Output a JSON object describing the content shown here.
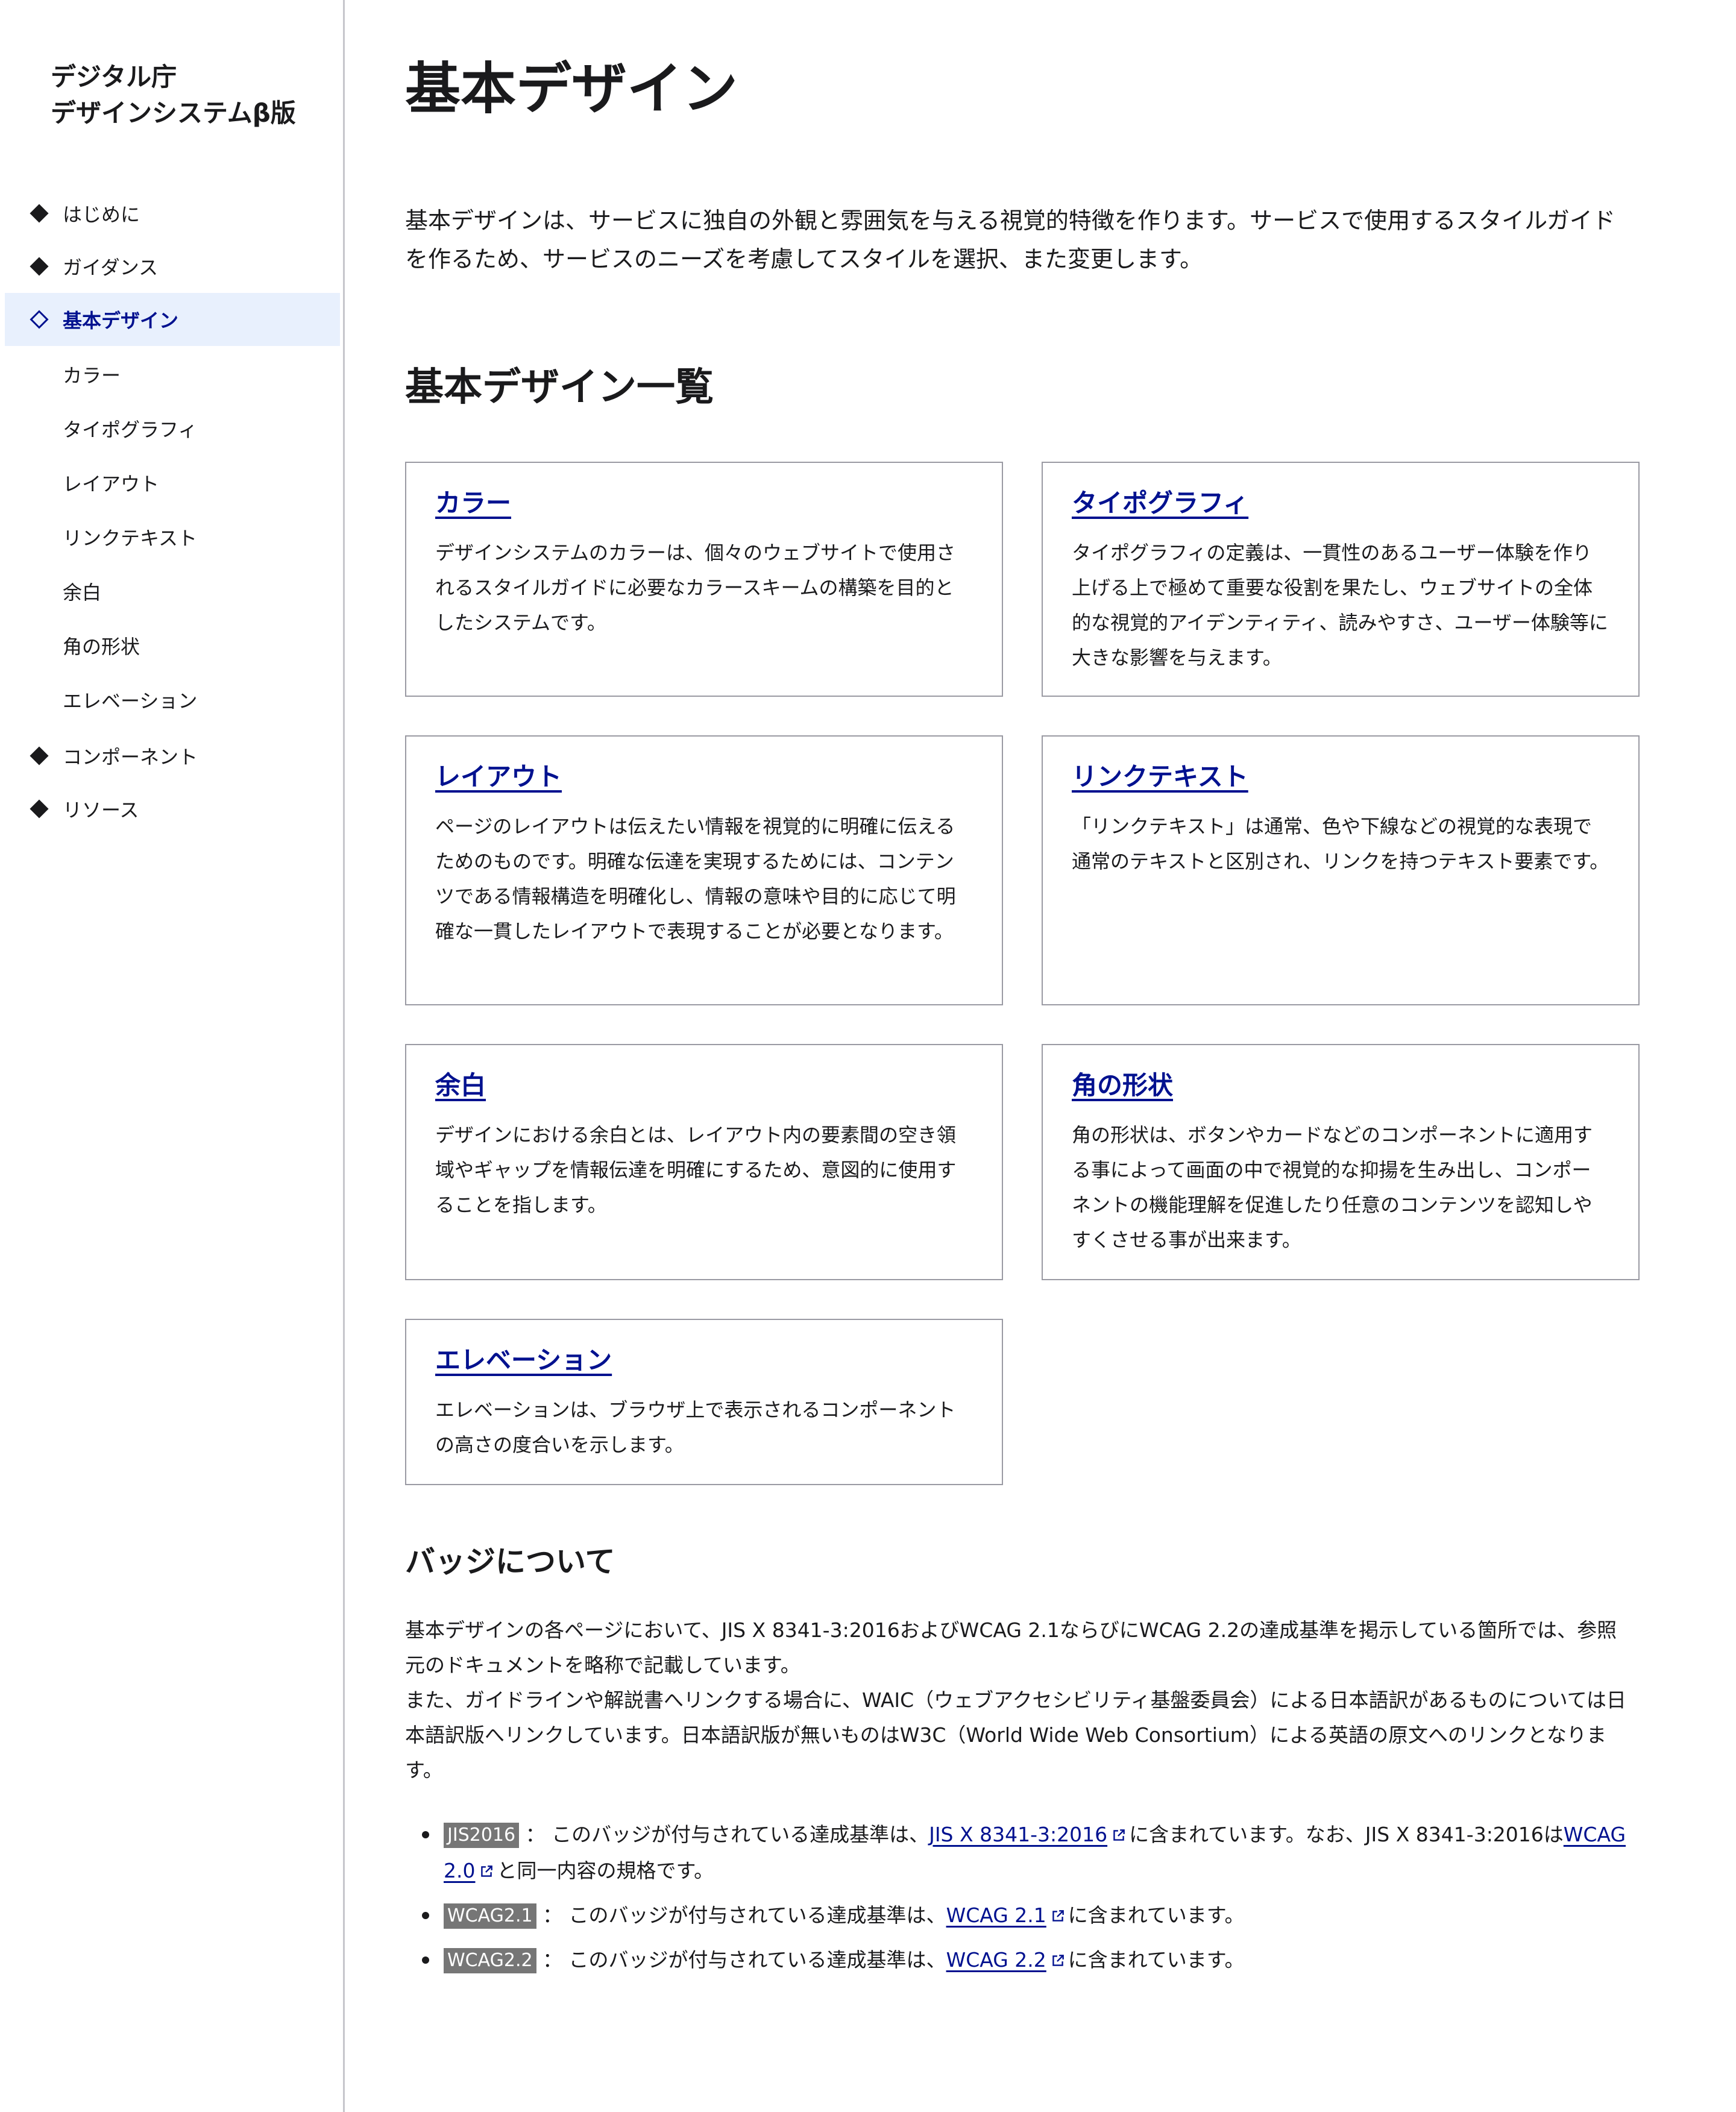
{
  "sidebar": {
    "brand_line1": "デジタル庁",
    "brand_line2": "デザインシステムβ版",
    "nav": {
      "intro": "はじめに",
      "guidance": "ガイダンス",
      "basic_design": "基本デザイン",
      "sub": [
        "カラー",
        "タイポグラフィ",
        "レイアウト",
        "リンクテキスト",
        "余白",
        "角の形状",
        "エレベーション"
      ],
      "components": "コンポーネント",
      "resources": "リソース"
    }
  },
  "main": {
    "title": "基本デザイン",
    "lead": "基本デザインは、サービスに独自の外観と雰囲気を与える視覚的特徴を作ります。サービスで使用するスタイルガイドを作るため、サービスのニーズを考慮してスタイルを選択、また変更します。",
    "list_heading": "基本デザイン一覧",
    "cards": [
      {
        "title": "カラー",
        "desc": "デザインシステムのカラーは、個々のウェブサイトで使用されるスタイルガイドに必要なカラースキームの構築を目的としたシステムです。"
      },
      {
        "title": "タイポグラフィ",
        "desc": "タイポグラフィの定義は、一貫性のあるユーザー体験を作り上げる上で極めて重要な役割を果たし、ウェブサイトの全体的な視覚的アイデンティティ、読みやすさ、ユーザー体験等に大きな影響を与えます。"
      },
      {
        "title": "レイアウト",
        "desc": "ページのレイアウトは伝えたい情報を視覚的に明確に伝えるためのものです。明確な伝達を実現するためには、コンテンツである情報構造を明確化し、情報の意味や目的に応じて明確な一貫したレイアウトで表現することが必要となります。"
      },
      {
        "title": "リンクテキスト",
        "desc": "「リンクテキスト」は通常、色や下線などの視覚的な表現で通常のテキストと区別され、リンクを持つテキスト要素です。"
      },
      {
        "title": "余白",
        "desc": "デザインにおける余白とは、レイアウト内の要素間の空き領域やギャップを情報伝達を明確にするため、意図的に使用することを指します。"
      },
      {
        "title": "角の形状",
        "desc": "角の形状は、ボタンやカードなどのコンポーネントに適用する事によって画面の中で視覚的な抑揚を生み出し、コンポーネントの機能理解を促進したり任意のコンテンツを認知しやすくさせる事が出来ます。"
      },
      {
        "title": "エレベーション",
        "desc": "エレベーションは、ブラウザ上で表示されるコンポーネントの高さの度合いを示します。"
      }
    ],
    "badge_section": {
      "heading": "バッジについて",
      "para1": "基本デザインの各ページにおいて、JIS X 8341-3:2016およびWCAG 2.1ならびにWCAG 2.2の達成基準を掲示している箇所では、参照元のドキュメントを略称で記載しています。",
      "para2": "また、ガイドラインや解説書へリンクする場合に、WAIC（ウェブアクセシビリティ基盤委員会）による日本語訳があるものについては日本語訳版へリンクしています。日本語訳版が無いものはW3C（World Wide Web Consortium）による英語の原文へのリンクとなります。",
      "items": [
        {
          "badge": "JIS2016",
          "text_before": "： このバッジが付与されている達成基準は、",
          "link": "JIS X 8341-3:2016",
          "text_mid": "に含まれています。なお、JIS X 8341-3:2016は",
          "link2": "WCAG 2.0",
          "text_after": "と同一内容の規格です。"
        },
        {
          "badge": "WCAG2.1",
          "text_before": "： このバッジが付与されている達成基準は、",
          "link": "WCAG 2.1",
          "text_after": "に含まれています。"
        },
        {
          "badge": "WCAG2.2",
          "text_before": "： このバッジが付与されている達成基準は、",
          "link": "WCAG 2.2",
          "text_after": "に含まれています。"
        }
      ]
    }
  },
  "colors": {
    "link": "#00118f",
    "active_bg": "#e8f0fd",
    "badge_bg": "#767676",
    "border": "#9a9aa3"
  },
  "icons": {
    "nav_bullet": "diamond-icon",
    "nav_active_bullet": "diamond-outline-icon",
    "external": "external-link-icon"
  }
}
